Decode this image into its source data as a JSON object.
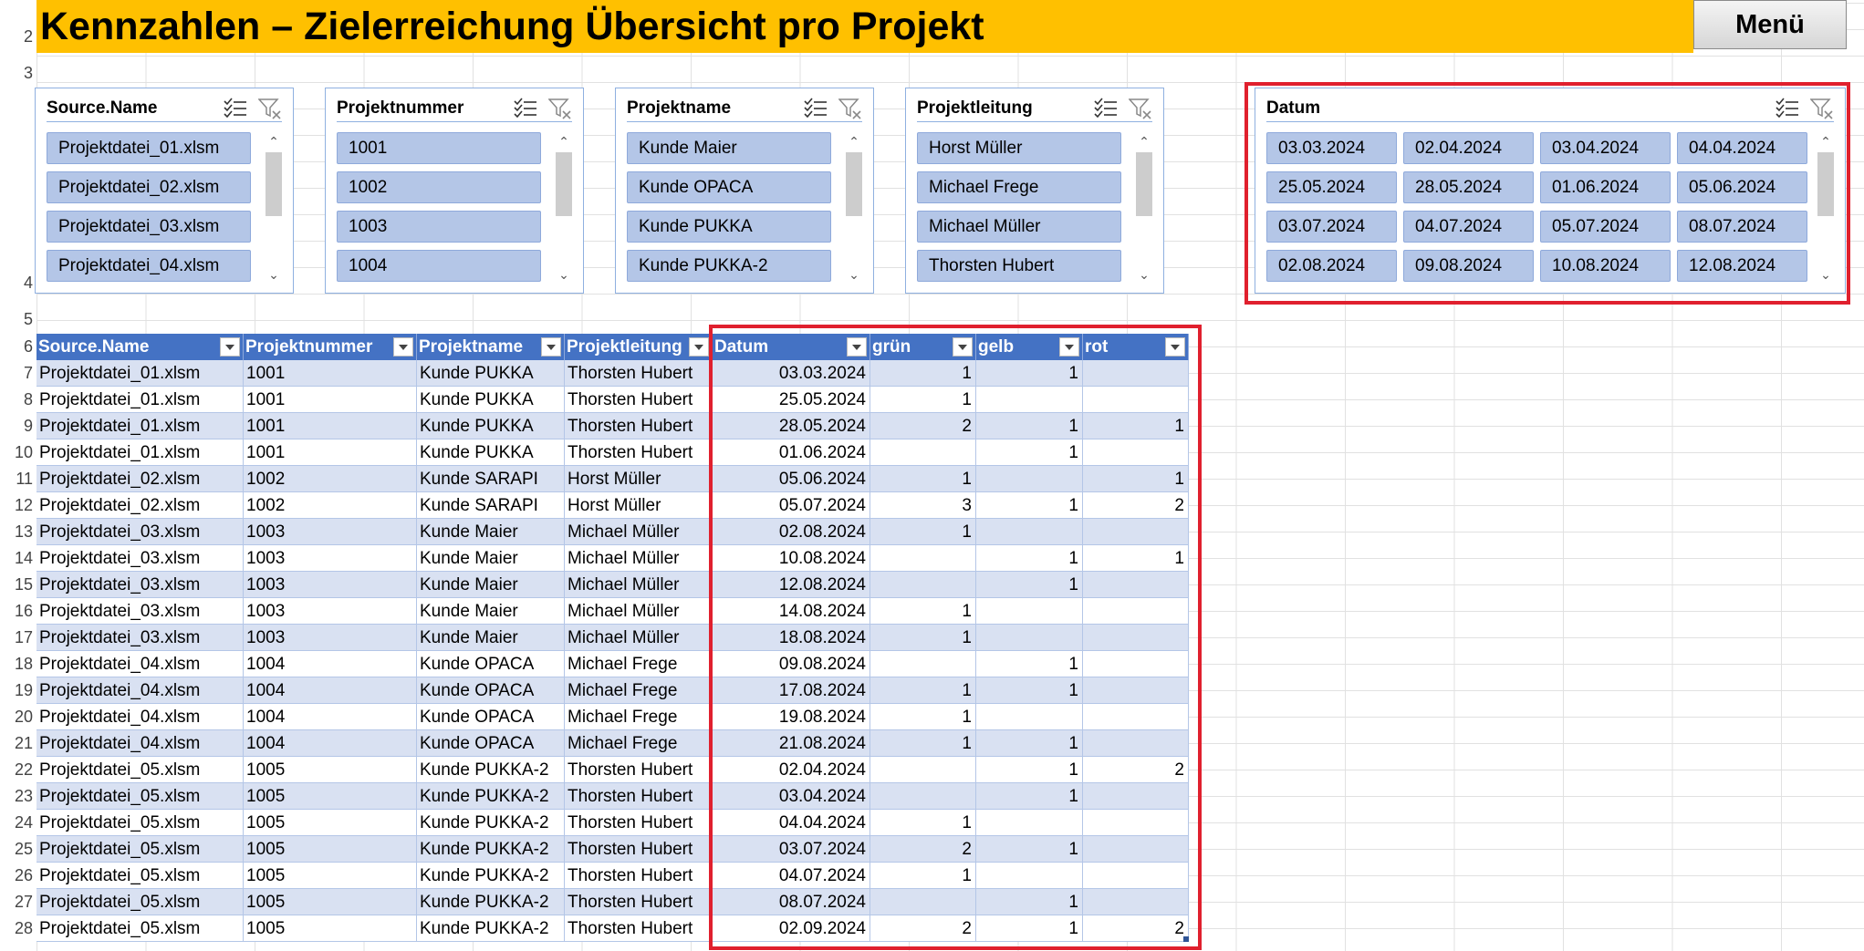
{
  "header": {
    "title": "Kennzahlen – Zielerreichung Übersicht pro Projekt",
    "menu_label": "Menü"
  },
  "row_numbers": [
    "2",
    "3",
    "4",
    "5",
    "6",
    "7",
    "8",
    "9",
    "10",
    "11",
    "12",
    "13",
    "14",
    "15",
    "16",
    "17",
    "18",
    "19",
    "20",
    "21",
    "22",
    "23",
    "24",
    "25",
    "26",
    "27",
    "28"
  ],
  "slicers": [
    {
      "title": "Source.Name",
      "items": [
        "Projektdatei_01.xlsm",
        "Projektdatei_02.xlsm",
        "Projektdatei_03.xlsm",
        "Projektdatei_04.xlsm"
      ]
    },
    {
      "title": "Projektnummer",
      "items": [
        "1001",
        "1002",
        "1003",
        "1004"
      ]
    },
    {
      "title": "Projektname",
      "items": [
        "Kunde Maier",
        "Kunde OPACA",
        "Kunde PUKKA",
        "Kunde PUKKA-2"
      ]
    },
    {
      "title": "Projektleitung",
      "items": [
        "Horst Müller",
        "Michael Frege",
        "Michael Müller",
        "Thorsten Hubert"
      ]
    },
    {
      "title": "Datum",
      "items": [
        "03.03.2024",
        "02.04.2024",
        "03.04.2024",
        "04.04.2024",
        "25.05.2024",
        "28.05.2024",
        "01.06.2024",
        "05.06.2024",
        "03.07.2024",
        "04.07.2024",
        "05.07.2024",
        "08.07.2024",
        "02.08.2024",
        "09.08.2024",
        "10.08.2024",
        "12.08.2024"
      ]
    }
  ],
  "table": {
    "headers": [
      "Source.Name",
      "Projektnummer",
      "Projektname",
      "Projektleitung",
      "Datum",
      "grün",
      "gelb",
      "rot"
    ],
    "rows": [
      [
        "Projektdatei_01.xlsm",
        "1001",
        "Kunde PUKKA",
        "Thorsten Hubert",
        "03.03.2024",
        "1",
        "1",
        ""
      ],
      [
        "Projektdatei_01.xlsm",
        "1001",
        "Kunde PUKKA",
        "Thorsten Hubert",
        "25.05.2024",
        "1",
        "",
        ""
      ],
      [
        "Projektdatei_01.xlsm",
        "1001",
        "Kunde PUKKA",
        "Thorsten Hubert",
        "28.05.2024",
        "2",
        "1",
        "1"
      ],
      [
        "Projektdatei_01.xlsm",
        "1001",
        "Kunde PUKKA",
        "Thorsten Hubert",
        "01.06.2024",
        "",
        "1",
        ""
      ],
      [
        "Projektdatei_02.xlsm",
        "1002",
        "Kunde SARAPI",
        "Horst Müller",
        "05.06.2024",
        "1",
        "",
        "1"
      ],
      [
        "Projektdatei_02.xlsm",
        "1002",
        "Kunde SARAPI",
        "Horst Müller",
        "05.07.2024",
        "3",
        "1",
        "2"
      ],
      [
        "Projektdatei_03.xlsm",
        "1003",
        "Kunde Maier",
        "Michael Müller",
        "02.08.2024",
        "1",
        "",
        ""
      ],
      [
        "Projektdatei_03.xlsm",
        "1003",
        "Kunde Maier",
        "Michael Müller",
        "10.08.2024",
        "",
        "1",
        "1"
      ],
      [
        "Projektdatei_03.xlsm",
        "1003",
        "Kunde Maier",
        "Michael Müller",
        "12.08.2024",
        "",
        "1",
        ""
      ],
      [
        "Projektdatei_03.xlsm",
        "1003",
        "Kunde Maier",
        "Michael Müller",
        "14.08.2024",
        "1",
        "",
        ""
      ],
      [
        "Projektdatei_03.xlsm",
        "1003",
        "Kunde Maier",
        "Michael Müller",
        "18.08.2024",
        "1",
        "",
        ""
      ],
      [
        "Projektdatei_04.xlsm",
        "1004",
        "Kunde OPACA",
        "Michael Frege",
        "09.08.2024",
        "",
        "1",
        ""
      ],
      [
        "Projektdatei_04.xlsm",
        "1004",
        "Kunde OPACA",
        "Michael Frege",
        "17.08.2024",
        "1",
        "1",
        ""
      ],
      [
        "Projektdatei_04.xlsm",
        "1004",
        "Kunde OPACA",
        "Michael Frege",
        "19.08.2024",
        "1",
        "",
        ""
      ],
      [
        "Projektdatei_04.xlsm",
        "1004",
        "Kunde OPACA",
        "Michael Frege",
        "21.08.2024",
        "1",
        "1",
        ""
      ],
      [
        "Projektdatei_05.xlsm",
        "1005",
        "Kunde PUKKA-2",
        "Thorsten Hubert",
        "02.04.2024",
        "",
        "1",
        "2"
      ],
      [
        "Projektdatei_05.xlsm",
        "1005",
        "Kunde PUKKA-2",
        "Thorsten Hubert",
        "03.04.2024",
        "",
        "1",
        ""
      ],
      [
        "Projektdatei_05.xlsm",
        "1005",
        "Kunde PUKKA-2",
        "Thorsten Hubert",
        "04.04.2024",
        "1",
        "",
        ""
      ],
      [
        "Projektdatei_05.xlsm",
        "1005",
        "Kunde PUKKA-2",
        "Thorsten Hubert",
        "03.07.2024",
        "2",
        "1",
        ""
      ],
      [
        "Projektdatei_05.xlsm",
        "1005",
        "Kunde PUKKA-2",
        "Thorsten Hubert",
        "04.07.2024",
        "1",
        "",
        ""
      ],
      [
        "Projektdatei_05.xlsm",
        "1005",
        "Kunde PUKKA-2",
        "Thorsten Hubert",
        "08.07.2024",
        "",
        "1",
        ""
      ],
      [
        "Projektdatei_05.xlsm",
        "1005",
        "Kunde PUKKA-2",
        "Thorsten Hubert",
        "02.09.2024",
        "2",
        "1",
        "2"
      ]
    ]
  },
  "colors": {
    "title_bar": "#ffc000",
    "table_header": "#4472c4",
    "band": "#d9e1f2",
    "slicer_item": "#b4c6e7",
    "highlight": "#e0202e"
  },
  "icons": {
    "multiselect": "multi-select-icon",
    "clear_filter": "clear-filter-icon",
    "filter_dropdown": "filter-dropdown-icon"
  }
}
